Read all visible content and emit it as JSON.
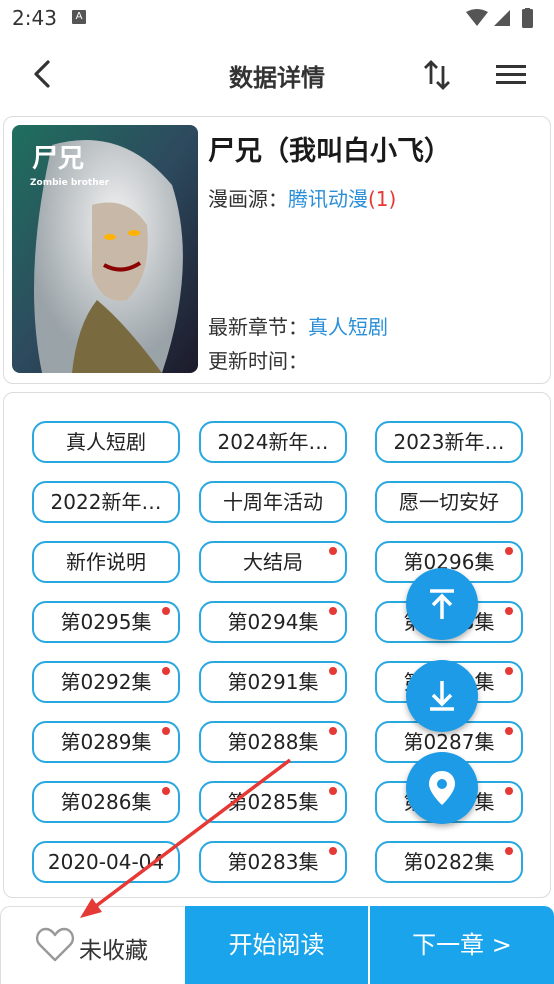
{
  "status_bar": {
    "time": "2:43",
    "notification_letter": "A"
  },
  "header": {
    "title": "数据详情",
    "back_icon": "arrow-back-icon",
    "sort_icon": "sort-icon",
    "menu_icon": "menu-icon"
  },
  "book": {
    "title": "尸兄（我叫白小飞）",
    "source_label": "漫画源：",
    "source_name": "腾讯动漫",
    "source_count": "(1)",
    "latest_label": "最新章节：",
    "latest_value": "真人短剧",
    "update_label": "更新时间：",
    "update_value": "",
    "cover_text": "尸兄",
    "cover_subtext": "Zombie brother"
  },
  "chapters": [
    {
      "label": "真人短剧",
      "new": false
    },
    {
      "label": "2024新年…",
      "new": false
    },
    {
      "label": "2023新年…",
      "new": false
    },
    {
      "label": "2022新年…",
      "new": false
    },
    {
      "label": "十周年活动",
      "new": false
    },
    {
      "label": "愿一切安好",
      "new": false
    },
    {
      "label": "新作说明",
      "new": false
    },
    {
      "label": "大结局",
      "new": true
    },
    {
      "label": "第0296集",
      "new": true
    },
    {
      "label": "第0295集",
      "new": true
    },
    {
      "label": "第0294集",
      "new": true
    },
    {
      "label": "第0293集",
      "new": true
    },
    {
      "label": "第0292集",
      "new": true
    },
    {
      "label": "第0291集",
      "new": true
    },
    {
      "label": "第0290集",
      "new": true
    },
    {
      "label": "第0289集",
      "new": true
    },
    {
      "label": "第0288集",
      "new": true
    },
    {
      "label": "第0287集",
      "new": true
    },
    {
      "label": "第0286集",
      "new": true
    },
    {
      "label": "第0285集",
      "new": true
    },
    {
      "label": "第0284集",
      "new": true
    },
    {
      "label": "2020-04-04",
      "new": false
    },
    {
      "label": "第0283集",
      "new": true
    },
    {
      "label": "第0282集",
      "new": true
    }
  ],
  "fabs": [
    {
      "name": "scroll-top-fab",
      "icon": "vertical-align-top-icon"
    },
    {
      "name": "scroll-bottom-fab",
      "icon": "vertical-align-bottom-icon"
    },
    {
      "name": "locate-fab",
      "icon": "location-pin-icon"
    }
  ],
  "bottom_bar": {
    "favorite_label": "未收藏",
    "read_label": "开始阅读",
    "next_label": "下一章 >"
  },
  "colors": {
    "accent": "#19a4ec",
    "chip_border": "#29a8e0",
    "link": "#2a8fd8",
    "badge": "#e53935"
  }
}
